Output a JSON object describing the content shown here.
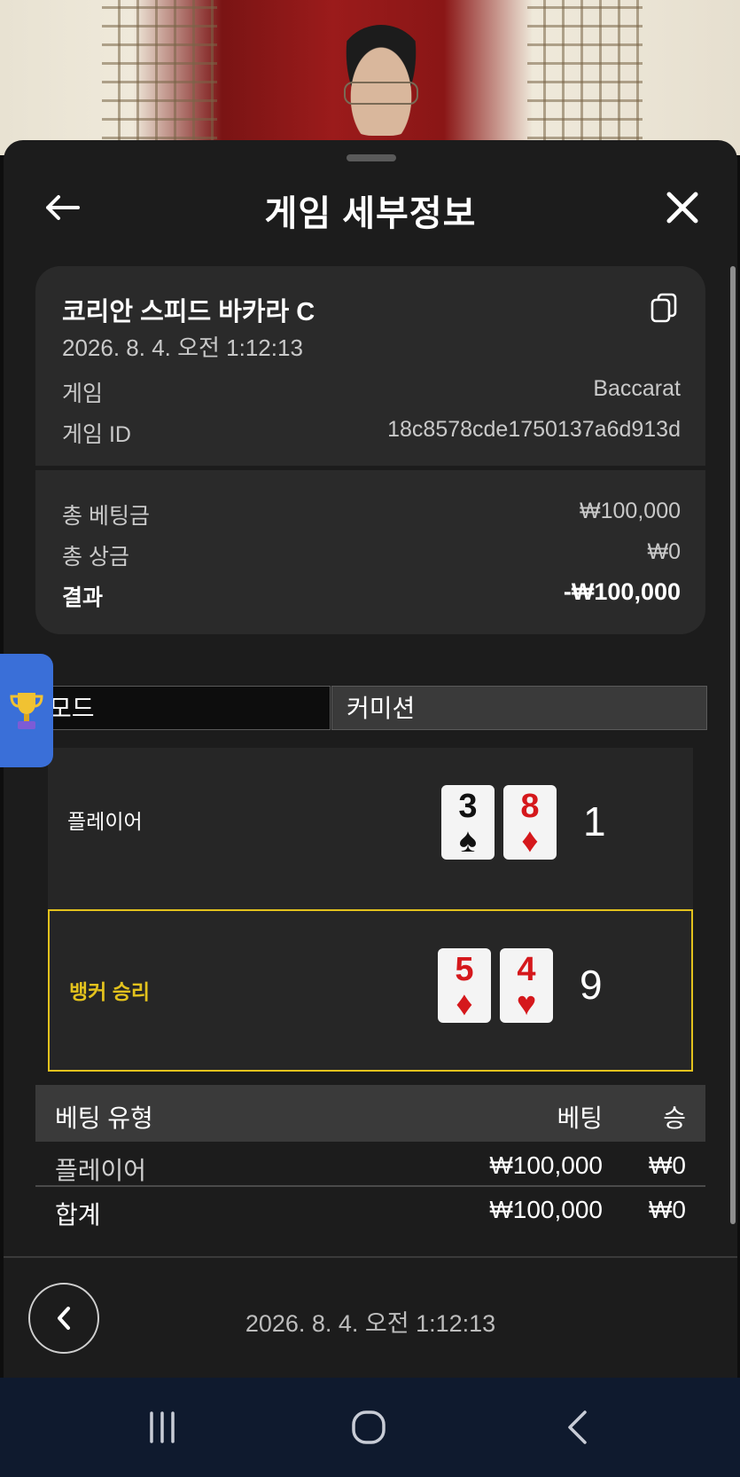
{
  "header": {
    "title": "게임 세부정보"
  },
  "game": {
    "name": "코리안 스피드 바카라 C",
    "datetime": "2026. 8. 4. 오전 1:12:13",
    "rows": [
      {
        "label": "게임",
        "value": "Baccarat"
      },
      {
        "label": "게임 ID",
        "value": "18c8578cde1750137a6d913d"
      }
    ]
  },
  "summary": {
    "total_bet_label": "총 베팅금",
    "total_bet": "₩100,000",
    "total_win_label": "총 상금",
    "total_win": "₩0",
    "result_label": "결과",
    "result": "-₩100,000"
  },
  "tabs": [
    {
      "label": "모드"
    },
    {
      "label": "커미션"
    }
  ],
  "player": {
    "label": "플레이어",
    "cards": [
      {
        "rank": "3",
        "suit": "♠"
      },
      {
        "rank": "8",
        "suit": "♦"
      }
    ],
    "score": "1"
  },
  "banker": {
    "label": "뱅커 승리",
    "cards": [
      {
        "rank": "5",
        "suit": "♦"
      },
      {
        "rank": "4",
        "suit": "♥"
      }
    ],
    "score": "9"
  },
  "bets": {
    "headers": {
      "type": "베팅 유형",
      "bet": "베팅",
      "win": "승"
    },
    "rows": [
      {
        "type": "플레이어",
        "bet": "₩100,000",
        "win": "₩0"
      }
    ],
    "total": {
      "type": "합계",
      "bet": "₩100,000",
      "win": "₩0"
    }
  },
  "footer": {
    "datetime": "2026. 8. 4. 오전 1:12:13"
  },
  "colors": {
    "accent_gold": "#e3c21d",
    "red_suit": "#d5181c",
    "badge_blue": "#3a6fd8"
  }
}
